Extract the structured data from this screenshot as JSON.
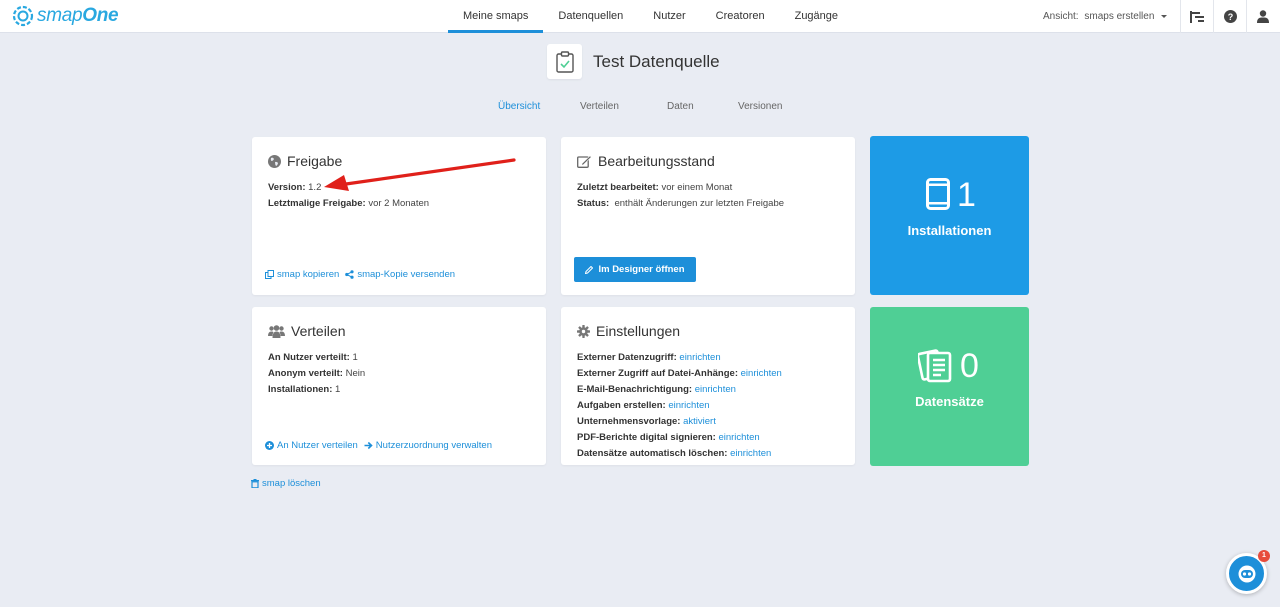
{
  "brand": {
    "name_prefix": "smap",
    "name_suffix": "One",
    "accent": "#1d8fd9"
  },
  "nav": {
    "items": [
      {
        "label": "Meine smaps",
        "active": true
      },
      {
        "label": "Datenquellen"
      },
      {
        "label": "Nutzer"
      },
      {
        "label": "Creatoren"
      },
      {
        "label": "Zugänge"
      }
    ],
    "view_label": "Ansicht:",
    "view_value": "smaps erstellen"
  },
  "header": {
    "title": "Test Datenquelle"
  },
  "subtabs": [
    {
      "label": "Übersicht",
      "active": true
    },
    {
      "label": "Verteilen"
    },
    {
      "label": "Daten"
    },
    {
      "label": "Versionen"
    }
  ],
  "freigabe": {
    "title": "Freigabe",
    "rows": [
      {
        "key": "Version:",
        "value": "1.2"
      },
      {
        "key": "Letztmalige Freigabe:",
        "value": "vor 2 Monaten"
      }
    ],
    "link_copy": "smap kopieren",
    "link_send": "smap-Kopie versenden"
  },
  "bearbeitung": {
    "title": "Bearbeitungsstand",
    "rows": [
      {
        "key": "Zuletzt bearbeitet:",
        "value": "vor einem Monat"
      },
      {
        "key": "Status:",
        "value": "enthält Änderungen zur letzten Freigabe"
      }
    ],
    "button": "Im Designer öffnen"
  },
  "installationen": {
    "count": "1",
    "label": "Installationen",
    "color": "#1d9be6"
  },
  "verteilen": {
    "title": "Verteilen",
    "rows": [
      {
        "key": "An Nutzer verteilt:",
        "value": "1"
      },
      {
        "key": "Anonym verteilt:",
        "value": "Nein"
      },
      {
        "key": "Installationen:",
        "value": "1"
      }
    ],
    "link_distribute": "An Nutzer verteilen",
    "link_manage": "Nutzerzuordnung verwalten"
  },
  "einstellungen": {
    "title": "Einstellungen",
    "rows": [
      {
        "key": "Externer Datenzugriff:",
        "value": "einrichten"
      },
      {
        "key": "Externer Zugriff auf Datei-Anhänge:",
        "value": "einrichten"
      },
      {
        "key": "E-Mail-Benachrichtigung:",
        "value": "einrichten"
      },
      {
        "key": "Aufgaben erstellen:",
        "value": "einrichten"
      },
      {
        "key": "Unternehmensvorlage:",
        "value": "aktiviert"
      },
      {
        "key": "PDF-Berichte digital signieren:",
        "value": "einrichten"
      },
      {
        "key": "Datensätze automatisch löschen:",
        "value": "einrichten"
      }
    ]
  },
  "datensaetze": {
    "count": "0",
    "label": "Datensätze",
    "color": "#4fcf95"
  },
  "delete_link": "smap löschen",
  "chat": {
    "badge": "1"
  }
}
